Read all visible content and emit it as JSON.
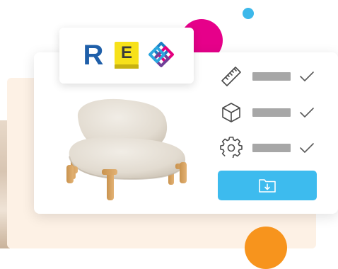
{
  "colors": {
    "accent_blue": "#3dbbee",
    "magenta": "#e6008a",
    "orange": "#f7941d",
    "panel_bg": "#fdf1e5",
    "bar_grey": "#a7a7a7"
  },
  "logos": {
    "revit": {
      "icon": "revit-logo",
      "letter": "R"
    },
    "edificius": {
      "icon": "edificius-logo",
      "letter": "E"
    },
    "ifc": {
      "icon": "ifc-logo"
    }
  },
  "product": {
    "icon": "armchair-image"
  },
  "features": [
    {
      "icon": "ruler-icon",
      "status": "check-icon"
    },
    {
      "icon": "cube-icon",
      "status": "check-icon"
    },
    {
      "icon": "gear-icon",
      "status": "check-icon"
    }
  ],
  "download_button": {
    "icon": "folder-download-icon"
  }
}
